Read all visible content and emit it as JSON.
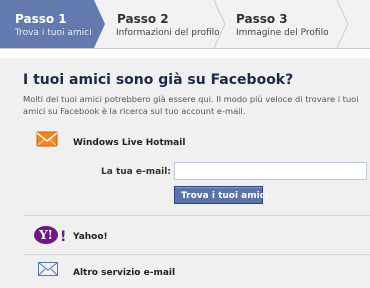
{
  "steps": [
    {
      "title": "Passo 1",
      "subtitle": "Trova i tuoi amici",
      "active": true
    },
    {
      "title": "Passo 2",
      "subtitle": "Informazioni del profilo",
      "active": false
    },
    {
      "title": "Passo 3",
      "subtitle": "Immagine del Profilo",
      "active": false
    }
  ],
  "main": {
    "heading": "I tuoi amici sono già su Facebook?",
    "intro": "Molti dei tuoi amici potrebbero già essere qui. Il modo più veloce di trovare i tuoi amici su Facebook è la ricerca sul tuo account e-mail."
  },
  "services": {
    "hotmail": {
      "name": "Windows Live Hotmail",
      "icon": "hotmail-envelope-icon"
    },
    "yahoo": {
      "name": "Yahoo!",
      "icon": "yahoo-logo-icon"
    },
    "other": {
      "name": "Altro servizio e-mail",
      "icon": "mail-envelope-icon"
    }
  },
  "form": {
    "email_label": "La tua e-mail:",
    "email_value": "",
    "find_button": "Trova i tuoi amici"
  },
  "colors": {
    "active_step": "#627aad",
    "button": "#5b74a8",
    "heading": "#1c2a47",
    "hotmail_orange": "#f0861d",
    "yahoo_purple": "#6f1a84"
  }
}
